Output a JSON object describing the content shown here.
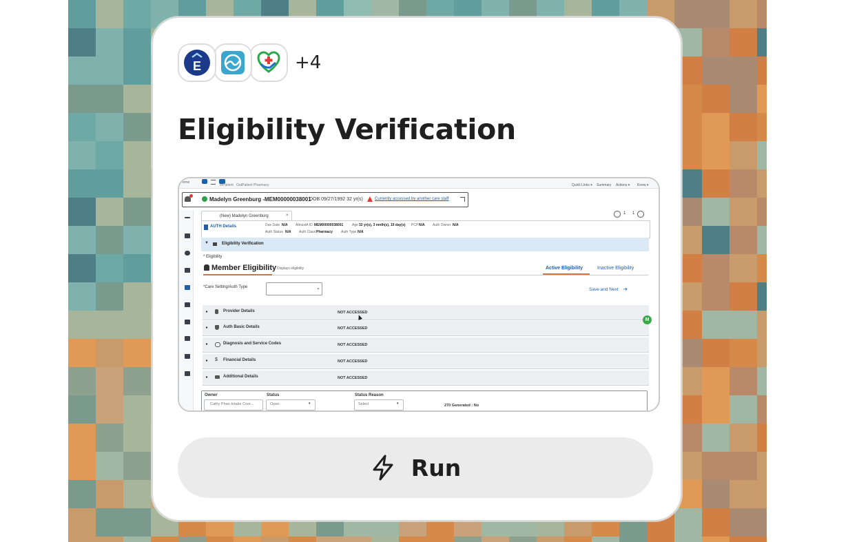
{
  "card": {
    "extra_count": "+4",
    "title": "Eligibility Verification",
    "run_label": "Run",
    "integration_icons": [
      "epic-logo-icon",
      "cloud-health-logo-icon",
      "care-heart-logo-icon"
    ]
  },
  "screenshot": {
    "top_nav": {
      "home": "Home",
      "inpatient": "InPatient",
      "outpatient": "OutPatient",
      "pharmacy": "Pharmacy",
      "quick_links": "Quick Links ▾",
      "summary": "Summary",
      "actions": "Actions ▾",
      "know": "Know ▾"
    },
    "patient_banner": {
      "name": "Madelyn Greenburg -MEM00000038001",
      "dob": "DOB 09/27/1992 32 yr(s)",
      "warning": "Currently accessed by another care staff"
    },
    "tab_label": "(New) Madelyn Greenburg",
    "pager": {
      "current": "1",
      "total": "1"
    },
    "auth_details": {
      "label": "AUTH Details",
      "fields": [
        {
          "label": "Due Date",
          "value": "N/A"
        },
        {
          "label": "AltruistA ID",
          "value": "MEM00000038001"
        },
        {
          "label": "Age",
          "value": "32 yr(s), 3 mnth(s), 19 day(s)"
        },
        {
          "label": "PCP",
          "value": "N/A"
        },
        {
          "label": "Auth Owner",
          "value": "N/A"
        },
        {
          "label": "Auth Status",
          "value": "N/A"
        },
        {
          "label": "Auth Class",
          "value": "Pharmacy"
        },
        {
          "label": "Auth Type",
          "value": "N/A"
        }
      ]
    },
    "section_header": "Eligibility Verification",
    "eligibility_label": "* Eligibility",
    "member_eligibility": "Member Eligibility",
    "displays_eligibility": "Displays eligibility",
    "tabs": {
      "active": "Active Eligibility",
      "inactive": "Inactive Eligibility"
    },
    "care_setting_label": "*Care Setting/Auth Type",
    "save_next": "Save and Next",
    "rows": [
      {
        "label": "Provider Details",
        "status": "NOT ACCESSED",
        "icon": "person-icon"
      },
      {
        "label": "Auth Basic Details",
        "status": "NOT ACCESSED",
        "icon": "shield-icon"
      },
      {
        "label": "Diagnosis and Service Codes",
        "status": "NOT ACCESSED",
        "icon": "stethoscope-icon"
      },
      {
        "label": "Financial Details",
        "status": "NOT ACCESSED",
        "icon": "dollar-icon"
      },
      {
        "label": "Additional Details",
        "status": "NOT ACCESSED",
        "icon": "folder-icon"
      }
    ],
    "avatar_initial": "M",
    "bottom_form": {
      "owner_label": "Owner",
      "owner_value": "Cathy Phan-Intake Coor...",
      "status_label": "Status",
      "status_value": "Open",
      "status_reason_label": "Status Reason",
      "status_reason_value": "Select",
      "generated_text": "270 Generated : No"
    }
  },
  "colors": {
    "accent_blue": "#1f5fa8",
    "section_band": "#dbe8f5",
    "row_grey": "#eceef1",
    "run_button": "#ebebeb",
    "title_text": "#1f1f1f"
  }
}
